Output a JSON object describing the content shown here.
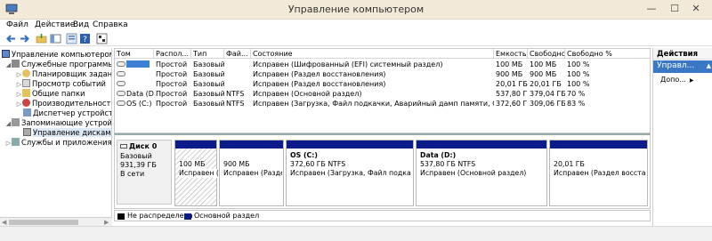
{
  "window": {
    "title": "Управление компьютером",
    "min": "—",
    "max": "☐",
    "close": "✕"
  },
  "menu": [
    "Файл",
    "Действие",
    "Вид",
    "Справка"
  ],
  "tree": {
    "root": "Управление компьютером (л",
    "items": [
      "Служебные программы",
      "Планировщик заданий",
      "Просмотр событий",
      "Общие папки",
      "Производительность",
      "Диспетчер устройств",
      "Запоминающие устройст",
      "Управление дисками",
      "Службы и приложения"
    ]
  },
  "volumes": {
    "headers": [
      "Том",
      "Распол...",
      "Тип",
      "Фай...",
      "Состояние",
      "Емкость",
      "Свободно",
      "Свободно %"
    ],
    "rows": [
      {
        "name": "",
        "layout": "Простой",
        "type": "Базовый",
        "fs": "",
        "status": "Исправен (Шифрованный (EFI) системный раздел)",
        "capacity": "100 МБ",
        "free": "100 МБ",
        "pct": "100 %"
      },
      {
        "name": "",
        "layout": "Простой",
        "type": "Базовый",
        "fs": "",
        "status": "Исправен (Раздел восстановления)",
        "capacity": "900 МБ",
        "free": "900 МБ",
        "pct": "100 %"
      },
      {
        "name": "",
        "layout": "Простой",
        "type": "Базовый",
        "fs": "",
        "status": "Исправен (Раздел восстановления)",
        "capacity": "20,01 ГБ",
        "free": "20,01 ГБ",
        "pct": "100 %"
      },
      {
        "name": "Data (D:)",
        "layout": "Простой",
        "type": "Базовый",
        "fs": "NTFS",
        "status": "Исправен (Основной раздел)",
        "capacity": "537,80 ГБ",
        "free": "379,04 ГБ",
        "pct": "70 %"
      },
      {
        "name": "OS (C:)",
        "layout": "Простой",
        "type": "Базовый",
        "fs": "NTFS",
        "status": "Исправен (Загрузка, Файл подкачки, Аварийный дамп памяти, Основной ...",
        "capacity": "372,60 ГБ",
        "free": "309,06 ГБ",
        "pct": "83 %"
      }
    ]
  },
  "disk": {
    "name": "Диск 0",
    "type": "Базовый",
    "size": "931,39 ГБ",
    "state": "В сети",
    "partitions": [
      {
        "line1": "",
        "line2": "100 МБ",
        "line3": "Исправен (Ц"
      },
      {
        "line1": "",
        "line2": "900 МБ",
        "line3": "Исправен (Раздел в"
      },
      {
        "line1": "OS  (C:)",
        "line2": "372,60 ГБ NTFS",
        "line3": "Исправен (Загрузка, Файл подкачки, А"
      },
      {
        "line1": "Data  (D:)",
        "line2": "537,80 ГБ NTFS",
        "line3": "Исправен (Основной раздел)"
      },
      {
        "line1": "",
        "line2": "20,01 ГБ",
        "line3": "Исправен (Раздел восстанов"
      }
    ]
  },
  "legend": {
    "unallocated": "Не распределена",
    "primary": "Основной раздел",
    "unallocated_color": "#000000",
    "primary_color": "#0b1b8a"
  },
  "actions": {
    "header": "Действия",
    "selected": "Управл...",
    "more": "Допо..."
  }
}
